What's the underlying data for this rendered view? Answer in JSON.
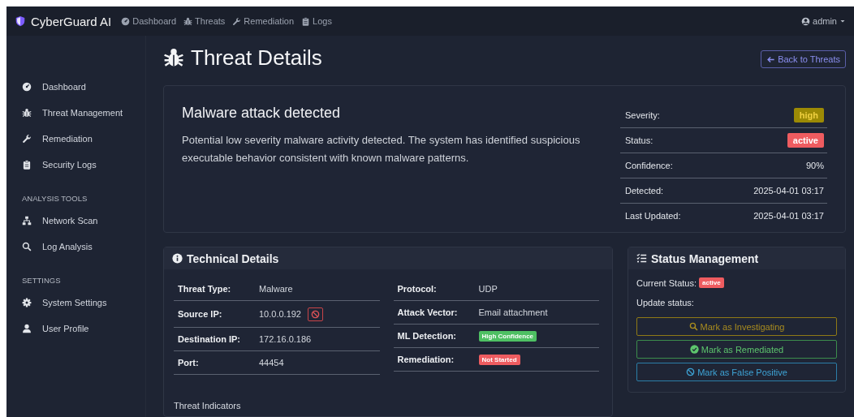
{
  "navbar": {
    "brand": "CyberGuard AI",
    "links": [
      {
        "label": "Dashboard"
      },
      {
        "label": "Threats"
      },
      {
        "label": "Remediation"
      },
      {
        "label": "Logs"
      }
    ],
    "user": "admin"
  },
  "sidebar": {
    "sections": [
      {
        "items": [
          {
            "label": "Dashboard"
          },
          {
            "label": "Threat Management"
          },
          {
            "label": "Remediation"
          },
          {
            "label": "Security Logs"
          }
        ]
      },
      {
        "heading": "ANALYSIS TOOLS",
        "items": [
          {
            "label": "Network Scan"
          },
          {
            "label": "Log Analysis"
          }
        ]
      },
      {
        "heading": "SETTINGS",
        "items": [
          {
            "label": "System Settings"
          },
          {
            "label": "User Profile"
          }
        ]
      }
    ]
  },
  "page": {
    "title": "Threat Details",
    "back_button": "Back to Threats"
  },
  "summary": {
    "title": "Malware attack detected",
    "description": "Potential low severity malware activity detected. The system has identified suspicious executable behavior consistent with known malware patterns.",
    "rows": [
      {
        "label": "Severity:",
        "badge": {
          "text": "high",
          "kind": "warning"
        }
      },
      {
        "label": "Status:",
        "badge": {
          "text": "active",
          "kind": "danger"
        }
      },
      {
        "label": "Confidence:",
        "value": "90%"
      },
      {
        "label": "Detected:",
        "value": "2025-04-01 03:17"
      },
      {
        "label": "Last Updated:",
        "value": "2025-04-01 03:17"
      }
    ]
  },
  "technical": {
    "title": "Technical Details",
    "columns": [
      [
        {
          "label": "Threat Type:",
          "value": "Malware"
        },
        {
          "label": "Source IP:",
          "value": "10.0.0.192",
          "block_button": true
        },
        {
          "label": "Destination IP:",
          "value": "172.16.0.186"
        },
        {
          "label": "Port:",
          "value": "44454"
        }
      ],
      [
        {
          "label": "Protocol:",
          "value": "UDP"
        },
        {
          "label": "Attack Vector:",
          "value": "Email attachment"
        },
        {
          "label": "ML Detection:",
          "badge": {
            "text": "High Confidence",
            "kind": "success"
          }
        },
        {
          "label": "Remediation:",
          "badge": {
            "text": "Not Started",
            "kind": "danger"
          }
        }
      ]
    ],
    "indicators_heading": "Threat Indicators"
  },
  "status_panel": {
    "title": "Status Management",
    "current_label": "Current Status:",
    "current_badge": {
      "text": "active",
      "kind": "danger"
    },
    "update_label": "Update status:",
    "buttons": [
      {
        "label": "Mark as Investigating",
        "kind": "warning"
      },
      {
        "label": "Mark as Remediated",
        "kind": "success"
      },
      {
        "label": "Mark as False Positive",
        "kind": "info"
      }
    ]
  }
}
